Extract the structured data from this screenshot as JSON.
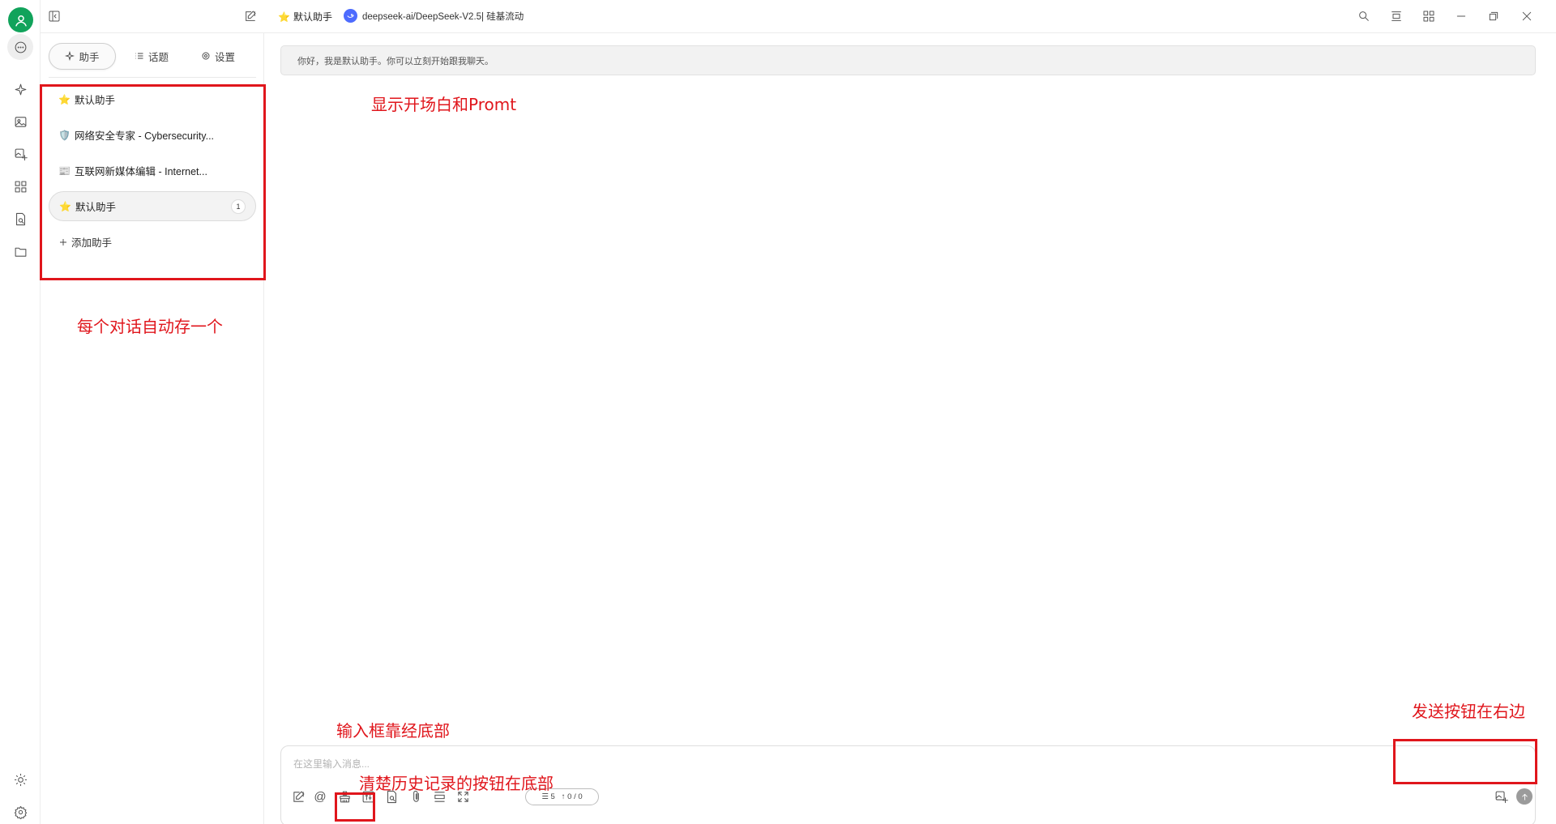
{
  "topbar": {
    "assistant_emoji": "⭐",
    "assistant_name": "默认助手",
    "model_label": "deepseek-ai/DeepSeek-V2.5| 硅基流动"
  },
  "sidebar": {
    "tabs": [
      {
        "label": "助手",
        "icon": "sparkle-icon",
        "active": true
      },
      {
        "label": "话题",
        "icon": "list-icon",
        "active": false
      },
      {
        "label": "设置",
        "icon": "gear-icon",
        "active": false
      }
    ],
    "assistants": [
      {
        "emoji": "⭐",
        "name": "默认助手"
      },
      {
        "emoji": "🛡️",
        "name": "网络安全专家 - Cybersecurity..."
      },
      {
        "emoji": "📰",
        "name": "互联网新媒体编辑 - Internet..."
      },
      {
        "emoji": "⭐",
        "name": "默认助手",
        "count": "1",
        "active": true
      }
    ],
    "add_label": "添加助手"
  },
  "main": {
    "system_message": "你好，我是默认助手。你可以立刻开始跟我聊天。",
    "input_placeholder": "在这里输入消息...",
    "token_context": "5",
    "token_usage": "0 / 0"
  },
  "annotations": {
    "prompt_note": "显示开场白和Promt",
    "conversation_note": "每个对话自动存一个",
    "input_note": "输入框靠经底部",
    "clear_note": "清楚历史记录的按钮在底部",
    "send_note": "发送按钮在右边"
  },
  "colors": {
    "accent_green": "#11a35b",
    "annotation_red": "#e0161c",
    "model_blue": "#4d6bfe"
  }
}
